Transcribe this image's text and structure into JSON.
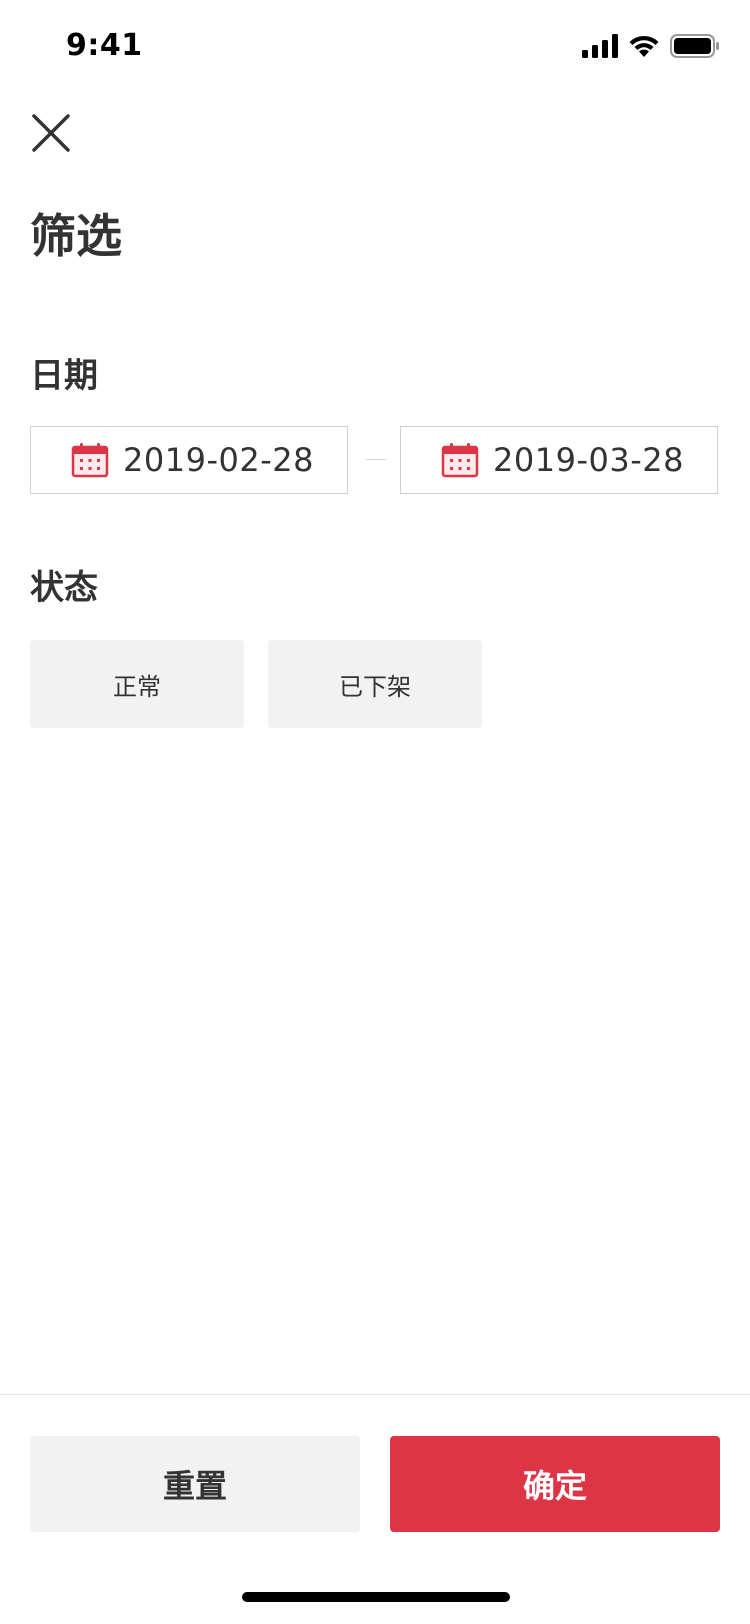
{
  "status_bar": {
    "time": "9:41"
  },
  "header": {
    "title": "筛选"
  },
  "date_section": {
    "label": "日期",
    "start_date": "2019-02-28",
    "end_date": "2019-03-28"
  },
  "status_section": {
    "label": "状态",
    "options": [
      "正常",
      "已下架"
    ]
  },
  "footer": {
    "reset_label": "重置",
    "confirm_label": "确定"
  },
  "colors": {
    "accent": "#dc3545",
    "chip_bg": "#f2f2f2",
    "text": "#333333"
  },
  "icons": {
    "close": "close-icon",
    "calendar": "calendar-icon",
    "signal": "signal-icon",
    "wifi": "wifi-icon",
    "battery": "battery-icon"
  }
}
